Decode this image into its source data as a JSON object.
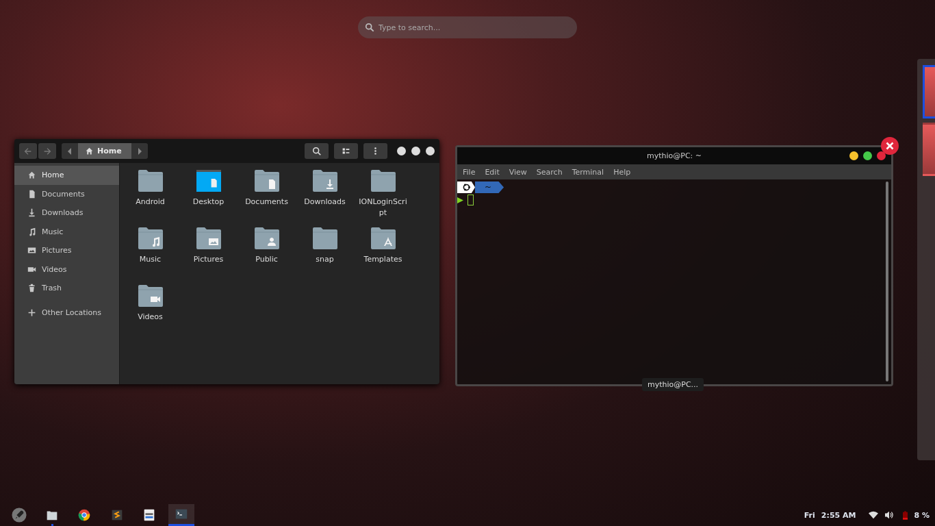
{
  "search": {
    "placeholder": "Type to search..."
  },
  "files_window": {
    "nav": [
      {
        "kind": "back",
        "disabled": true
      },
      {
        "kind": "forward",
        "disabled": true
      }
    ],
    "path": [
      {
        "label": "Home",
        "selected": true
      }
    ],
    "sidebar": [
      {
        "label": "Home",
        "kind": "home",
        "selected": true
      },
      {
        "label": "Documents",
        "kind": "document",
        "selected": false
      },
      {
        "label": "Downloads",
        "kind": "download",
        "selected": false
      },
      {
        "label": "Music",
        "kind": "music",
        "selected": false
      },
      {
        "label": "Pictures",
        "kind": "pictures",
        "selected": false
      },
      {
        "label": "Videos",
        "kind": "video",
        "selected": false
      },
      {
        "label": "Trash",
        "kind": "trash",
        "selected": false
      },
      {
        "label": "Other Locations",
        "kind": "add",
        "selected": false
      }
    ],
    "folders": [
      {
        "name": "Android",
        "kind": "plain"
      },
      {
        "name": "Desktop",
        "kind": "desktop"
      },
      {
        "name": "Documents",
        "kind": "document"
      },
      {
        "name": "Downloads",
        "kind": "download"
      },
      {
        "name": "IONLoginScript",
        "kind": "plain"
      },
      {
        "name": "Music",
        "kind": "music"
      },
      {
        "name": "Pictures",
        "kind": "pictures"
      },
      {
        "name": "Public",
        "kind": "public"
      },
      {
        "name": "snap",
        "kind": "plain"
      },
      {
        "name": "Templates",
        "kind": "templates"
      },
      {
        "name": "Videos",
        "kind": "video"
      }
    ]
  },
  "terminal_window": {
    "title": "mythio@PC: ~",
    "menu": [
      "File",
      "Edit",
      "View",
      "Search",
      "Terminal",
      "Help"
    ],
    "prompt_dir": "~",
    "tooltip": "mythio@PC..."
  },
  "workspaces": [
    {
      "selected": true
    },
    {
      "selected": false
    }
  ],
  "dock": [
    {
      "kind": "launcher",
      "running": false,
      "selected": false
    },
    {
      "kind": "files",
      "running": true,
      "selected": false
    },
    {
      "kind": "browser",
      "running": false,
      "selected": false
    },
    {
      "kind": "editor",
      "running": false,
      "selected": false
    },
    {
      "kind": "settings",
      "running": false,
      "selected": false
    },
    {
      "kind": "terminal",
      "running": true,
      "selected": true
    }
  ],
  "status": {
    "day": "Fri",
    "time": "2:55 AM",
    "battery": "8 %"
  }
}
